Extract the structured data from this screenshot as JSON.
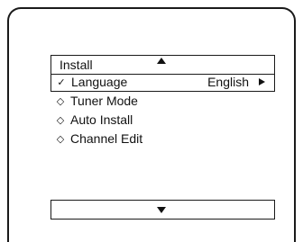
{
  "menu": {
    "title": "Install",
    "scroll_up_icon": "triangle-up",
    "scroll_down_icon": "triangle-down",
    "items": [
      {
        "label": "Language",
        "marker": "✓",
        "marker_icon": "checkmark",
        "value": "English",
        "submenu_icon": "triangle-right",
        "selected": true
      },
      {
        "label": "Tuner Mode",
        "marker": "◇",
        "marker_icon": "diamond-outline",
        "selected": false
      },
      {
        "label": "Auto Install",
        "marker": "◇",
        "marker_icon": "diamond-outline",
        "selected": false
      },
      {
        "label": "Channel Edit",
        "marker": "◇",
        "marker_icon": "diamond-outline",
        "selected": false
      }
    ]
  }
}
